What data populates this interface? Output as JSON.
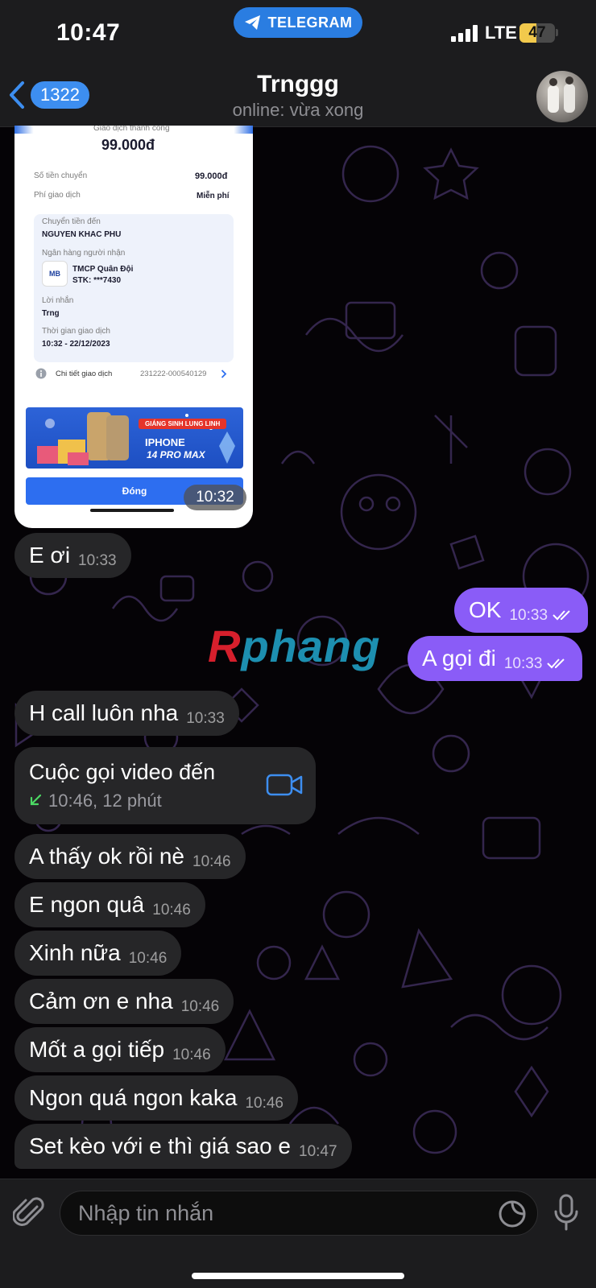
{
  "status_bar": {
    "time": "10:47",
    "app_pill": "TELEGRAM",
    "network": "LTE",
    "battery": "47",
    "battery_level": 0.47
  },
  "header": {
    "back_count": "1322",
    "title": "Trnggg",
    "subtitle": "online: vừa xong"
  },
  "receipt": {
    "status": "Giao dịch thành công",
    "amount": "99.000đ",
    "transfer_amount_label": "Số tiền chuyển",
    "transfer_amount": "99.000đ",
    "fee_label": "Phí giao dịch",
    "fee": "Miễn phí",
    "to_label": "Chuyển tiền đến",
    "to_name": "NGUYEN KHAC PHU",
    "bank_label": "Ngân hàng người nhận",
    "bank_logo": "MB",
    "bank_name": "TMCP Quân Đội",
    "account": "STK: ***7430",
    "note_label": "Lời nhắn",
    "note": "Trng",
    "time_label": "Thời gian giao dịch",
    "time": "10:32 - 22/12/2023",
    "detail_label": "Chi tiết giao dịch",
    "detail_code": "231222-000540129",
    "banner_tag": "GIÁNG SINH LUNG LINH",
    "banner_title": "IPHONE",
    "banner_sub": "14 PRO MAX",
    "close_button": "Đóng",
    "msg_time": "10:32"
  },
  "watermark": {
    "first": "R",
    "rest": "phang"
  },
  "messages": [
    {
      "dir": "in",
      "text": "E ơi",
      "time": "10:33"
    },
    {
      "dir": "out",
      "text": "OK",
      "time": "10:33"
    },
    {
      "dir": "out",
      "text": "A gọi đi",
      "time": "10:33"
    },
    {
      "dir": "in",
      "text": "H call luôn nha",
      "time": "10:33"
    },
    {
      "dir": "in",
      "text": "A thấy ok rồi nè",
      "time": "10:46"
    },
    {
      "dir": "in",
      "text": "E ngon quâ",
      "time": "10:46"
    },
    {
      "dir": "in",
      "text": "Xinh nữa",
      "time": "10:46"
    },
    {
      "dir": "in",
      "text": "Cảm ơn e nha",
      "time": "10:46"
    },
    {
      "dir": "in",
      "text": "Mốt a gọi tiếp",
      "time": "10:46"
    },
    {
      "dir": "in",
      "text": "Ngon quá ngon kaka",
      "time": "10:46"
    },
    {
      "dir": "in",
      "text": "Set kèo với e thì giá sao e",
      "time": "10:47"
    }
  ],
  "call": {
    "title": "Cuộc gọi video đến",
    "detail": "10:46, 12 phút"
  },
  "composer": {
    "placeholder": "Nhập tin nhắn"
  },
  "icons": [
    "telegram-icon",
    "back-chevron-icon",
    "video-camera-icon",
    "incoming-arrow-icon",
    "paperclip-icon",
    "sticker-icon",
    "microphone-icon",
    "double-check-icon",
    "info-icon",
    "chevron-right-icon"
  ],
  "colors": {
    "outgoing": "#8a5cf7",
    "incoming": "#262628",
    "accent": "#3d8ef0",
    "header": "#1c1c1e"
  }
}
